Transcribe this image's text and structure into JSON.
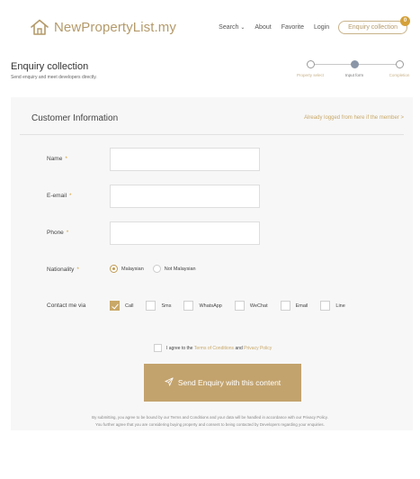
{
  "header": {
    "logo_text": "NewPropertyList.my",
    "nav": {
      "search": "Search",
      "about": "About",
      "favorite": "Favorite",
      "login": "Login",
      "enquiry": "Enquiry collection",
      "enquiry_count": "0"
    }
  },
  "page": {
    "title": "Enquiry collection",
    "subtitle": "Send enquiry and meet developers directly."
  },
  "steps": [
    {
      "label": "Property select",
      "active": false
    },
    {
      "label": "Input form",
      "active": true
    },
    {
      "label": "Completion",
      "active": false
    }
  ],
  "form": {
    "section_title": "Customer Information",
    "login_link": "Already logged from here if the member",
    "login_chevron": ">",
    "required_mark": "*",
    "fields": {
      "name": {
        "label": "Name",
        "value": "",
        "placeholder": ""
      },
      "email": {
        "label": "E-email",
        "value": "",
        "placeholder": ""
      },
      "phone": {
        "label": "Phone",
        "value": "",
        "placeholder": ""
      }
    },
    "nationality": {
      "label": "Nationality",
      "options": [
        "Malaysian",
        "Not Malaysian"
      ],
      "selected": "Malaysian"
    },
    "contact": {
      "label": "Contact me via",
      "options": [
        "Call",
        "Sms",
        "WhatsApp",
        "WeChat",
        "Email",
        "Line"
      ],
      "checked": [
        "Call"
      ]
    },
    "agree": {
      "prefix": "I agree to the",
      "terms": "Terms of Conditions",
      "and": "and",
      "privacy": "Privacy Policy"
    },
    "submit_label": "Send Enquiry with this content",
    "disclaimer_line1": "By submitting, you agree to be bound by our Terms and Conditions and your data will be handled in accordance with our Privacy Policy.",
    "disclaimer_line2": "You further agree that you are considering buying property and consent to being contacted by Developers regarding your enquiries."
  },
  "colors": {
    "brand": "#b49a6a",
    "accent": "#c3a36d",
    "badge": "#d4a13a"
  }
}
